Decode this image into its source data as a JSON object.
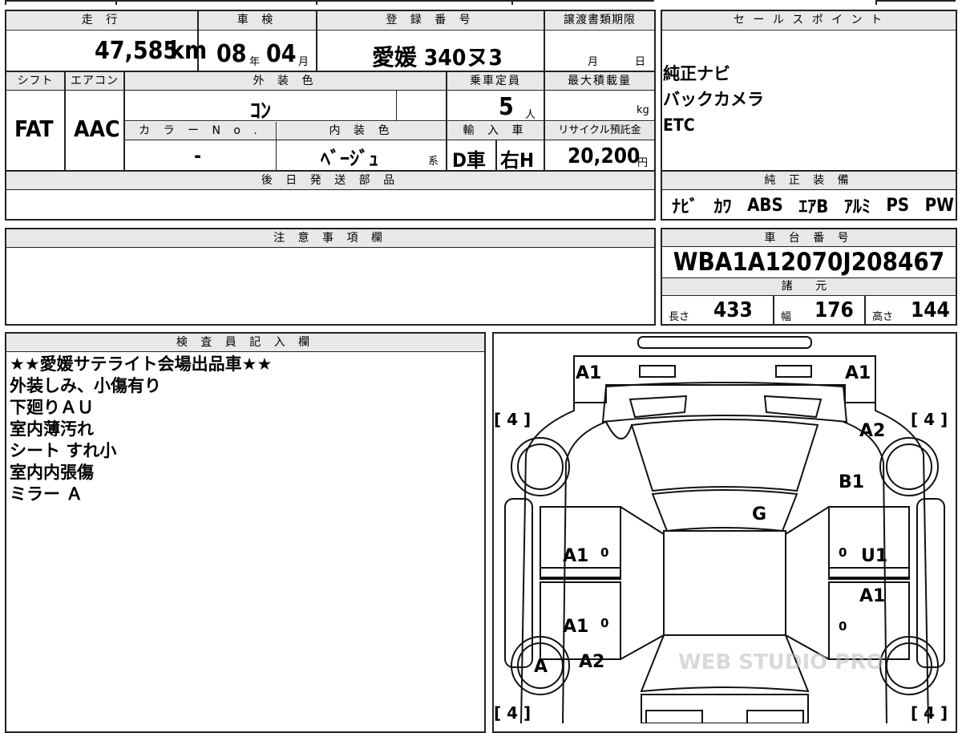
{
  "headers": {
    "mileage": "走 行",
    "inspection": "車 検",
    "registration": "登 録 番 号",
    "transfer_deadline": "譲渡書類期限",
    "sales_point": "セ ー ル ス ポ イ ン ト",
    "shift": "シフト",
    "aircon": "エアコン",
    "exterior_color": "外 装 色",
    "capacity": "乗車定員",
    "max_load": "最大積載量",
    "color_no": "カ ラ ー N o .",
    "interior_color": "内 装 色",
    "import": "輸 入 車",
    "recycle": "リサイクル預託金",
    "later_parts": "後 日 発 送 部 品",
    "standard_equipment": "純 正 装 備",
    "notes": "注 意 事 項 欄",
    "chassis": "車 台 番 号",
    "specs": "諸 元",
    "inspector": "検 査 員 記 入 欄"
  },
  "values": {
    "mileage": "47,585",
    "mileage_unit": "km",
    "inspection_year": "08",
    "year_unit": "年",
    "inspection_month": "04",
    "month_unit": "月",
    "registration": "愛媛 340ヌ3",
    "deadline_month": "月",
    "deadline_day": "日",
    "shift": "FAT",
    "aircon": "AAC",
    "exterior_color": "ｺﾝ",
    "capacity": "5",
    "capacity_unit": "人",
    "max_load_unit": "kg",
    "color_no": "-",
    "interior_color": "ﾍﾞｰｼﾞｭ",
    "interior_suffix": "系",
    "import_type": "D車",
    "handle": "右H",
    "recycle": "20,200",
    "recycle_unit": "円",
    "chassis_no": "WBA1A12070J208467",
    "length_label": "長さ",
    "length": "433",
    "width_label": "幅",
    "width": "176",
    "height_label": "高さ",
    "height": "144"
  },
  "sales_points": [
    "純正ナビ",
    "バックカメラ",
    "ETC"
  ],
  "equipment": [
    "ﾅﾋﾞ",
    "ｶﾜ",
    "ABS",
    "ｴｱB",
    "ｱﾙﾐ",
    "PS",
    "PW"
  ],
  "inspector_notes": [
    "★★愛媛サテライト会場出品車★★",
    "外装しみ、小傷有り",
    "下廻りＡＵ",
    "室内薄汚れ",
    "シート すれ小",
    "室内内張傷",
    "ミラー Ａ"
  ],
  "diagram": {
    "front_left": "A1",
    "front_right": "A1",
    "tire_fl": "[ 4 ]",
    "tire_fr": "[ 4 ]",
    "tire_rl": "[ 4 ]",
    "tire_rr": "[ 4 ]",
    "fender_right": "A2",
    "fender_right_lower": "B1",
    "windshield": "G",
    "door_left_front": "A1",
    "door_right_front": "U1",
    "door_right_rear": "A1",
    "door_left_rear": "A1",
    "wheel_rear_left": "A",
    "quarter_left": "A2",
    "zero": "0"
  },
  "watermark": "WEB STUDIO PRO"
}
